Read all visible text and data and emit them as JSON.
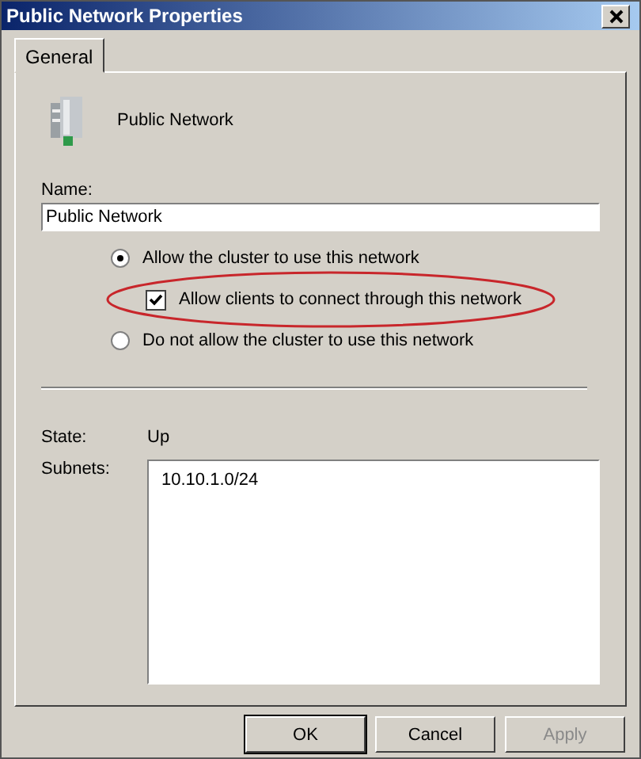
{
  "window": {
    "title": "Public Network Properties"
  },
  "tabs": [
    {
      "label": "General",
      "selected": true
    }
  ],
  "network": {
    "name": "Public Network"
  },
  "name_field": {
    "label": "Name:",
    "value": "Public Network"
  },
  "options": [
    {
      "kind": "radio",
      "label": "Allow the cluster to use this network",
      "selected": true
    },
    {
      "kind": "checkbox",
      "label": "Allow clients to connect through this network",
      "checked": true,
      "highlighted": true
    },
    {
      "kind": "radio",
      "label": "Do not allow the cluster to use this network",
      "selected": false
    }
  ],
  "state": {
    "label": "State:",
    "value": "Up"
  },
  "subnets": {
    "label": "Subnets:",
    "items": [
      "10.10.1.0/24"
    ]
  },
  "buttons": [
    {
      "label": "OK",
      "disabled": false
    },
    {
      "label": "Cancel",
      "disabled": false
    },
    {
      "label": "Apply",
      "disabled": true
    }
  ]
}
